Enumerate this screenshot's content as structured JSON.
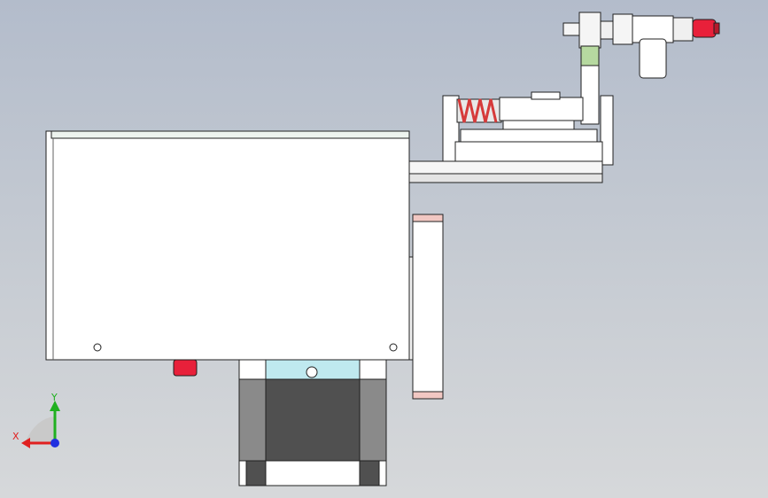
{
  "viewport": {
    "background_top": "#b3bccb",
    "background_bottom": "#d6d8da"
  },
  "model": {
    "part_fill": "#ffffff",
    "edge_color": "#202020",
    "accent_cyan": "#bfe9ef",
    "accent_green": "#b6d9a0",
    "accent_red": "#e8203a",
    "accent_pink": "#f1c7c2",
    "spring_color": "#d63a3a",
    "motor_dark": "#505050",
    "motor_mid": "#8a8a8a"
  },
  "triad": {
    "x_label": "X",
    "y_label": "Y",
    "x_color": "#e02020",
    "y_color": "#20b020",
    "z_color": "#2030e0"
  }
}
